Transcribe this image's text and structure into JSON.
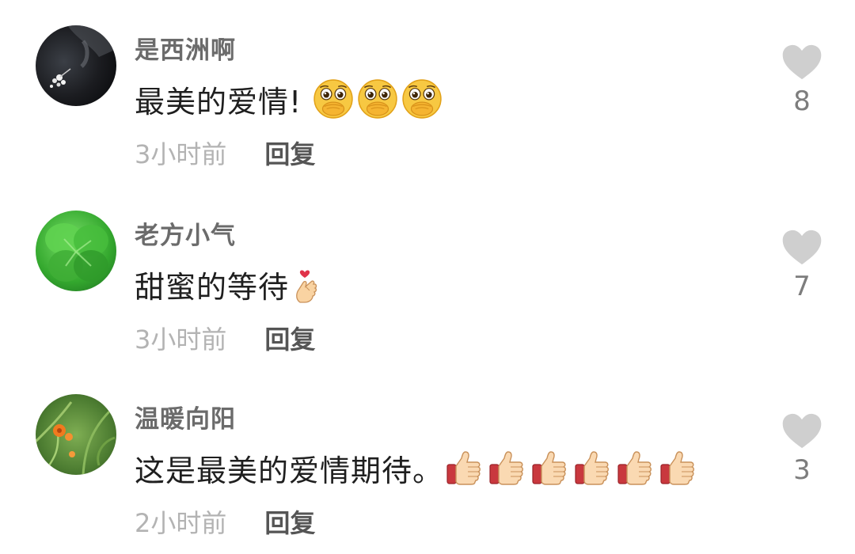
{
  "comments": [
    {
      "username": "是西洲啊",
      "text": "最美的爱情!",
      "emojis": [
        "pleading-face-emoji",
        "pleading-face-emoji",
        "pleading-face-emoji"
      ],
      "time": "3小时前",
      "reply_label": "回复",
      "likes": "8",
      "avatar": "dark-flower-photo"
    },
    {
      "username": "老方小气",
      "text": "甜蜜的等待",
      "emojis": [
        "finger-heart-emoji"
      ],
      "time": "3小时前",
      "reply_label": "回复",
      "likes": "7",
      "avatar": "green-clover-photo"
    },
    {
      "username": "温暖向阳",
      "text": "这是最美的爱情期待。",
      "emojis": [
        "thumbs-up-emoji",
        "thumbs-up-emoji",
        "thumbs-up-emoji",
        "thumbs-up-emoji",
        "thumbs-up-emoji",
        "thumbs-up-emoji"
      ],
      "time": "2小时前",
      "reply_label": "回复",
      "likes": "3",
      "avatar": "orange-flower-photo"
    }
  ],
  "colors": {
    "username": "#6b6b6b",
    "text": "#1f1f1f",
    "time": "#b3b3b3",
    "reply": "#555555",
    "heart": "#cfcfcf",
    "like_count": "#7d7d7d"
  }
}
